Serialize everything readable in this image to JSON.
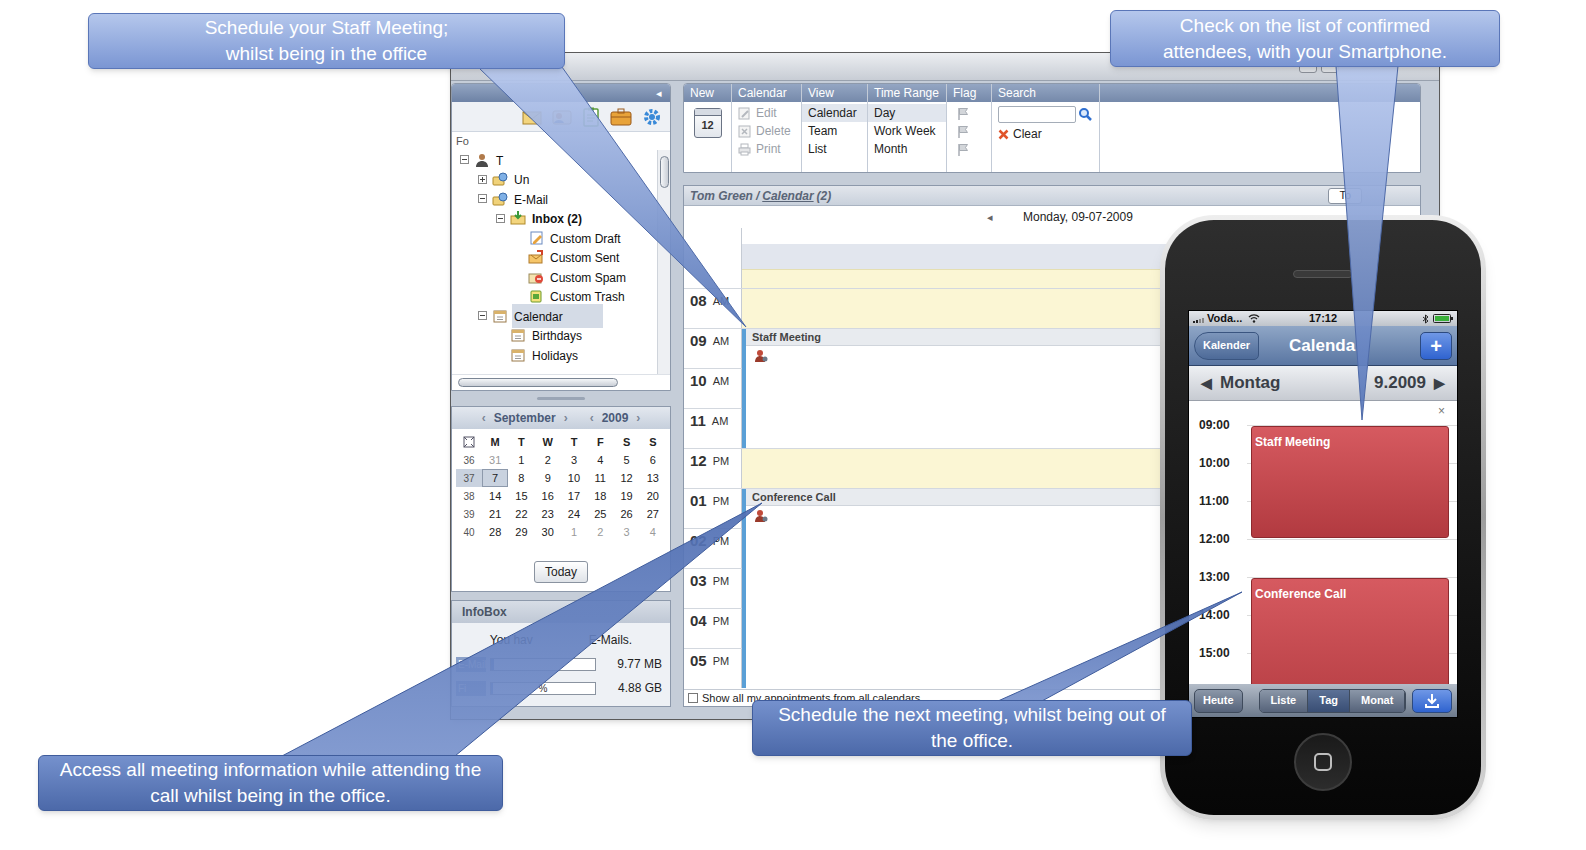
{
  "callouts": [
    {
      "text": "Schedule your Staff Meeting; whilst being in the office"
    },
    {
      "text": "Check on the list of confirmed attendees, with your Smartphone."
    },
    {
      "text": "Access all meeting information while attending the call whilst being in the office."
    },
    {
      "text": "Schedule the next meeting, whilst being out of the office."
    }
  ],
  "desktop": {
    "sidebar": {
      "collapse": "◂",
      "folders_label": "Fo",
      "tree": [
        {
          "label": "T",
          "level": 0,
          "kind": "user",
          "expander": "open",
          "unread": false,
          "selected": false
        },
        {
          "label": "Un",
          "level": 1,
          "kind": "account",
          "expander": "closed",
          "unread": false,
          "selected": false
        },
        {
          "label": "E-Mail",
          "level": 1,
          "kind": "account",
          "expander": "open",
          "unread": false,
          "selected": false
        },
        {
          "label": "Inbox (2)",
          "level": 2,
          "kind": "inbox",
          "expander": "open",
          "unread": true,
          "selected": false
        },
        {
          "label": "Custom Draft",
          "level": 3,
          "kind": "drafts",
          "expander": "none",
          "unread": false,
          "selected": false
        },
        {
          "label": "Custom Sent",
          "level": 3,
          "kind": "sent",
          "expander": "none",
          "unread": false,
          "selected": false
        },
        {
          "label": "Custom Spam",
          "level": 3,
          "kind": "spam",
          "expander": "none",
          "unread": false,
          "selected": false
        },
        {
          "label": "Custom Trash",
          "level": 3,
          "kind": "trash",
          "expander": "none",
          "unread": false,
          "selected": false
        },
        {
          "label": "Calendar",
          "level": 1,
          "kind": "calendar",
          "expander": "open",
          "unread": false,
          "selected": true
        },
        {
          "label": "Birthdays",
          "level": 2,
          "kind": "calendar",
          "expander": "none",
          "unread": false,
          "selected": false
        },
        {
          "label": "Holidays",
          "level": 2,
          "kind": "calendar",
          "expander": "none",
          "unread": false,
          "selected": false
        }
      ]
    },
    "mini_calendar": {
      "prev_month": "‹",
      "month": "September",
      "next_month": "›",
      "prev_year": "‹",
      "year": "2009",
      "next_year": "›",
      "weekdays": [
        "M",
        "T",
        "W",
        "T",
        "F",
        "S",
        "S"
      ],
      "weeks": [
        {
          "number": "36",
          "selected": false,
          "days": [
            {
              "day": "31",
              "other": true,
              "today": false
            },
            {
              "day": "1",
              "other": false,
              "today": false
            },
            {
              "day": "2",
              "other": false,
              "today": false
            },
            {
              "day": "3",
              "other": false,
              "today": false
            },
            {
              "day": "4",
              "other": false,
              "today": false
            },
            {
              "day": "5",
              "other": false,
              "today": false
            },
            {
              "day": "6",
              "other": false,
              "today": false
            }
          ]
        },
        {
          "number": "37",
          "selected": true,
          "days": [
            {
              "day": "7",
              "other": false,
              "today": true
            },
            {
              "day": "8",
              "other": false,
              "today": false
            },
            {
              "day": "9",
              "other": false,
              "today": false
            },
            {
              "day": "10",
              "other": false,
              "today": false
            },
            {
              "day": "11",
              "other": false,
              "today": false
            },
            {
              "day": "12",
              "other": false,
              "today": false
            },
            {
              "day": "13",
              "other": false,
              "today": false
            }
          ]
        },
        {
          "number": "38",
          "selected": false,
          "days": [
            {
              "day": "14",
              "other": false,
              "today": false
            },
            {
              "day": "15",
              "other": false,
              "today": false
            },
            {
              "day": "16",
              "other": false,
              "today": false
            },
            {
              "day": "17",
              "other": false,
              "today": false
            },
            {
              "day": "18",
              "other": false,
              "today": false
            },
            {
              "day": "19",
              "other": false,
              "today": false
            },
            {
              "day": "20",
              "other": false,
              "today": false
            }
          ]
        },
        {
          "number": "39",
          "selected": false,
          "days": [
            {
              "day": "21",
              "other": false,
              "today": false
            },
            {
              "day": "22",
              "other": false,
              "today": false
            },
            {
              "day": "23",
              "other": false,
              "today": false
            },
            {
              "day": "24",
              "other": false,
              "today": false
            },
            {
              "day": "25",
              "other": false,
              "today": false
            },
            {
              "day": "26",
              "other": false,
              "today": false
            },
            {
              "day": "27",
              "other": false,
              "today": false
            }
          ]
        },
        {
          "number": "40",
          "selected": false,
          "days": [
            {
              "day": "28",
              "other": false,
              "today": false
            },
            {
              "day": "29",
              "other": false,
              "today": false
            },
            {
              "day": "30",
              "other": false,
              "today": false
            },
            {
              "day": "1",
              "other": true,
              "today": false
            },
            {
              "day": "2",
              "other": true,
              "today": false
            },
            {
              "day": "3",
              "other": true,
              "today": false
            },
            {
              "day": "4",
              "other": true,
              "today": false
            }
          ]
        }
      ],
      "today_button": "Today"
    },
    "infobox": {
      "title": "InfoBox",
      "message_start": "You hav",
      "message_end": "E-Mails.",
      "quotas": [
        {
          "label": "E-Mail",
          "level": 0.03,
          "value": "9.77 MB"
        },
        {
          "label": "Fi",
          "bar_text": "%",
          "level": 0.02,
          "value": "4.88 GB"
        }
      ]
    },
    "toolbar": {
      "groups": [
        {
          "title": "New",
          "kind": "new",
          "icon_text": "12"
        },
        {
          "title": "Calendar",
          "kind": "actions",
          "items": [
            {
              "label": "Edit",
              "disabled": true
            },
            {
              "label": "Delete",
              "disabled": true
            },
            {
              "label": "Print",
              "disabled": true
            }
          ]
        },
        {
          "title": "View",
          "kind": "options",
          "items": [
            {
              "label": "Calendar",
              "selected": true
            },
            {
              "label": "Team",
              "selected": false
            },
            {
              "label": "List",
              "selected": false
            }
          ]
        },
        {
          "title": "Time Range",
          "kind": "options",
          "items": [
            {
              "label": "Day",
              "selected": true
            },
            {
              "label": "Work Week",
              "selected": false
            },
            {
              "label": "Month",
              "selected": false
            }
          ]
        },
        {
          "title": "Flag",
          "kind": "flags",
          "items": [
            {
              "disabled": true
            },
            {
              "disabled": true
            },
            {
              "disabled": true
            }
          ]
        },
        {
          "title": "Search",
          "kind": "search",
          "placeholder": "",
          "clear": "Clear"
        }
      ]
    },
    "calendar": {
      "owner": "Tom Green",
      "separator": "/",
      "folder": "Calendar",
      "count": "(2)",
      "today_button": "To",
      "prev": "◂",
      "date": "Monday, 09-07-2009",
      "hours": [
        {
          "label": "08",
          "ampm": "AM",
          "off_hours": true
        },
        {
          "label": "09",
          "ampm": "AM",
          "off_hours": false
        },
        {
          "label": "10",
          "ampm": "AM",
          "off_hours": false
        },
        {
          "label": "11",
          "ampm": "AM",
          "off_hours": false
        },
        {
          "label": "12",
          "ampm": "PM",
          "off_hours": true
        },
        {
          "label": "01",
          "ampm": "PM",
          "off_hours": false
        },
        {
          "label": "02",
          "ampm": "PM",
          "off_hours": false
        },
        {
          "label": "03",
          "ampm": "PM",
          "off_hours": false
        },
        {
          "label": "04",
          "ampm": "PM",
          "off_hours": false
        },
        {
          "label": "05",
          "ampm": "PM",
          "off_hours": false
        }
      ],
      "events": [
        {
          "title": "Staff Meeting",
          "start": 9,
          "end": 12
        },
        {
          "title": "Conference Call",
          "start": 13,
          "end": 18
        }
      ],
      "show_all": {
        "label": "Show all my appointments from all calendars",
        "checked": false
      }
    }
  },
  "phone": {
    "carrier": "Voda...",
    "time": "17:12",
    "back": "Kalender",
    "title": "Calenda",
    "add": "+",
    "prev": "◀",
    "day": "Montag",
    "date": "9.2009",
    "next": "▶",
    "close": "×",
    "times": [
      "09:00",
      "10:00",
      "11:00",
      "12:00",
      "13:00",
      "14:00",
      "15:00"
    ],
    "events": [
      {
        "title": "Staff Meeting",
        "start": 9,
        "end": 12
      },
      {
        "title": "Conference Call",
        "start": 13,
        "end": 17
      }
    ],
    "tabs": [
      {
        "label": "Heute",
        "kind": "button",
        "selected": false
      },
      {
        "label": "Liste",
        "kind": "segment",
        "selected": false
      },
      {
        "label": "Tag",
        "kind": "segment",
        "selected": true
      },
      {
        "label": "Monat",
        "kind": "segment",
        "selected": false
      }
    ]
  }
}
